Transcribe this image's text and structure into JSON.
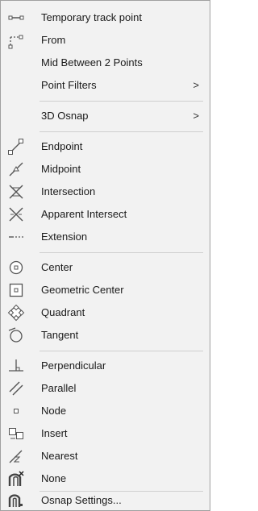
{
  "menu": {
    "items": [
      {
        "label": "Temporary track point",
        "icon": "temporary-track-point-icon"
      },
      {
        "label": "From",
        "icon": "from-icon"
      },
      {
        "label": "Mid Between 2 Points",
        "icon": ""
      },
      {
        "label": "Point Filters",
        "icon": "",
        "submenu_arrow": ">"
      },
      {
        "label": "3D Osnap",
        "icon": "",
        "submenu_arrow": ">"
      },
      {
        "label": "Endpoint",
        "icon": "endpoint-icon"
      },
      {
        "label": "Midpoint",
        "icon": "midpoint-icon"
      },
      {
        "label": "Intersection",
        "icon": "intersection-icon"
      },
      {
        "label": "Apparent Intersect",
        "icon": "apparent-intersect-icon"
      },
      {
        "label": "Extension",
        "icon": "extension-icon"
      },
      {
        "label": "Center",
        "icon": "center-icon"
      },
      {
        "label": "Geometric Center",
        "icon": "geometric-center-icon"
      },
      {
        "label": "Quadrant",
        "icon": "quadrant-icon"
      },
      {
        "label": "Tangent",
        "icon": "tangent-icon"
      },
      {
        "label": "Perpendicular",
        "icon": "perpendicular-icon"
      },
      {
        "label": "Parallel",
        "icon": "parallel-icon"
      },
      {
        "label": "Node",
        "icon": "node-icon"
      },
      {
        "label": "Insert",
        "icon": "insert-icon"
      },
      {
        "label": "Nearest",
        "icon": "nearest-icon"
      },
      {
        "label": "None",
        "icon": "none-icon"
      },
      {
        "label": "Osnap Settings...",
        "icon": "osnap-settings-icon"
      }
    ]
  },
  "colors": {
    "background": "#f2f2f2",
    "text": "#1a1a1a",
    "separator": "#cfcfcf",
    "icon": "#4a4a4a"
  }
}
